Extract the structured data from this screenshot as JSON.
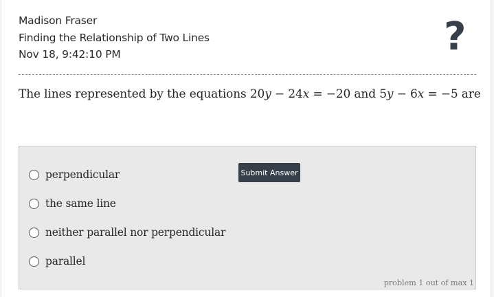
{
  "header": {
    "student_name": "Madison Fraser",
    "assignment_title": "Finding the Relationship of Two Lines",
    "timestamp": "Nov 18, 9:42:10 PM",
    "help_symbol": "?"
  },
  "question": {
    "prefix": "The lines represented by the equations",
    "equation1": {
      "c1": "20",
      "v1": "y",
      "op": "−",
      "c2": "24",
      "v2": "x",
      "eq": "=",
      "rhs": "−20"
    },
    "connector": "and",
    "equation2": {
      "c1": "5",
      "v1": "y",
      "op": "−",
      "c2": "6",
      "v2": "x",
      "eq": "=",
      "rhs": "−5"
    },
    "suffix": "are"
  },
  "answers": {
    "options": [
      {
        "label": "perpendicular"
      },
      {
        "label": "the same line"
      },
      {
        "label": "neither parallel nor perpendicular"
      },
      {
        "label": "parallel"
      }
    ],
    "submit_label": "Submit Answer"
  },
  "footer": {
    "progress": "problem 1 out of max 1"
  }
}
